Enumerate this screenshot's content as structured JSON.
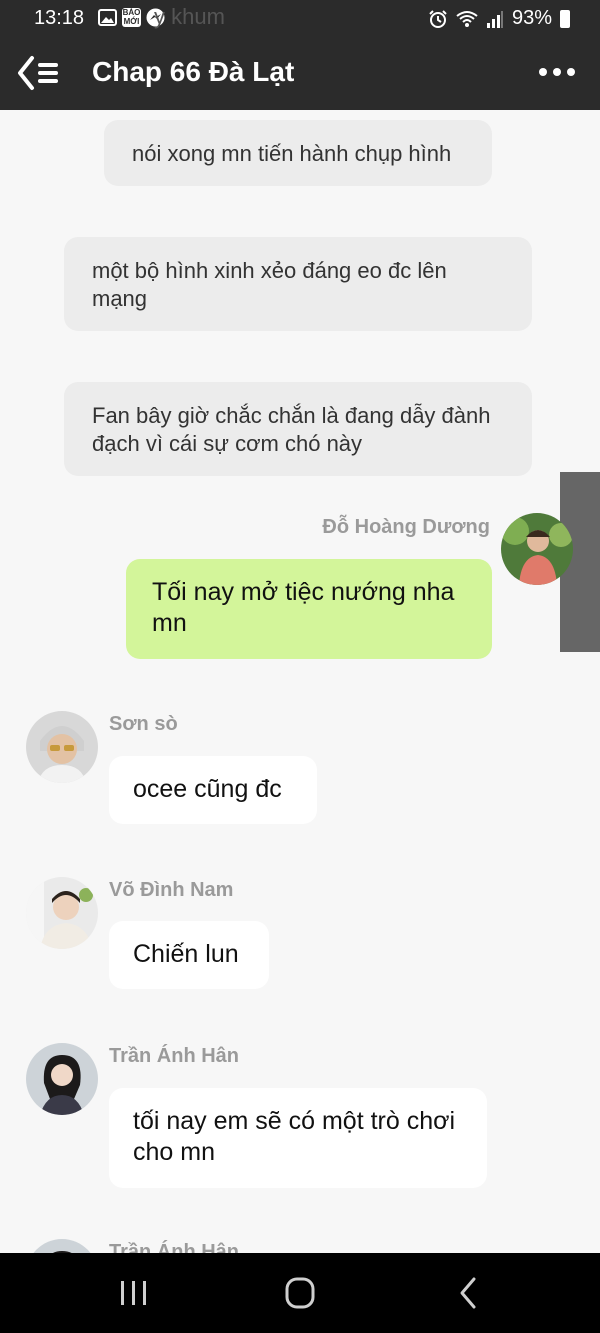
{
  "status_bar": {
    "time": "13:18",
    "app_badge_text": "BÁO MỚI",
    "bg_text": "y khum",
    "battery": "93%"
  },
  "header": {
    "title": "Chap 66 Đà Lạt"
  },
  "messages": [
    {
      "text": "nói xong mn tiến hành chụp hình"
    },
    {
      "text": "một bộ hình xinh xẻo đáng eo đc lên mạng"
    },
    {
      "text": "Fan bây giờ chắc chắn là đang dẫy đành đạch vì cái sự cơm chó này"
    },
    {
      "sender": "Đỗ Hoàng Dương",
      "text": "Tối nay mở tiệc nướng nha mn"
    },
    {
      "sender": "Sơn sò",
      "text": "ocee cũng đc"
    },
    {
      "sender": "Võ Đình Nam",
      "text": "Chiến lun"
    },
    {
      "sender": "Trần Ánh Hân",
      "text": "tối nay em sẽ có một trò chơi cho mn"
    },
    {
      "sender": "Trần Ánh Hân"
    }
  ],
  "colors": {
    "header_bg": "#2b2b2b",
    "own_bubble": "#d3f59a",
    "other_bubble": "#ffffff",
    "system_bubble": "#ececec"
  }
}
